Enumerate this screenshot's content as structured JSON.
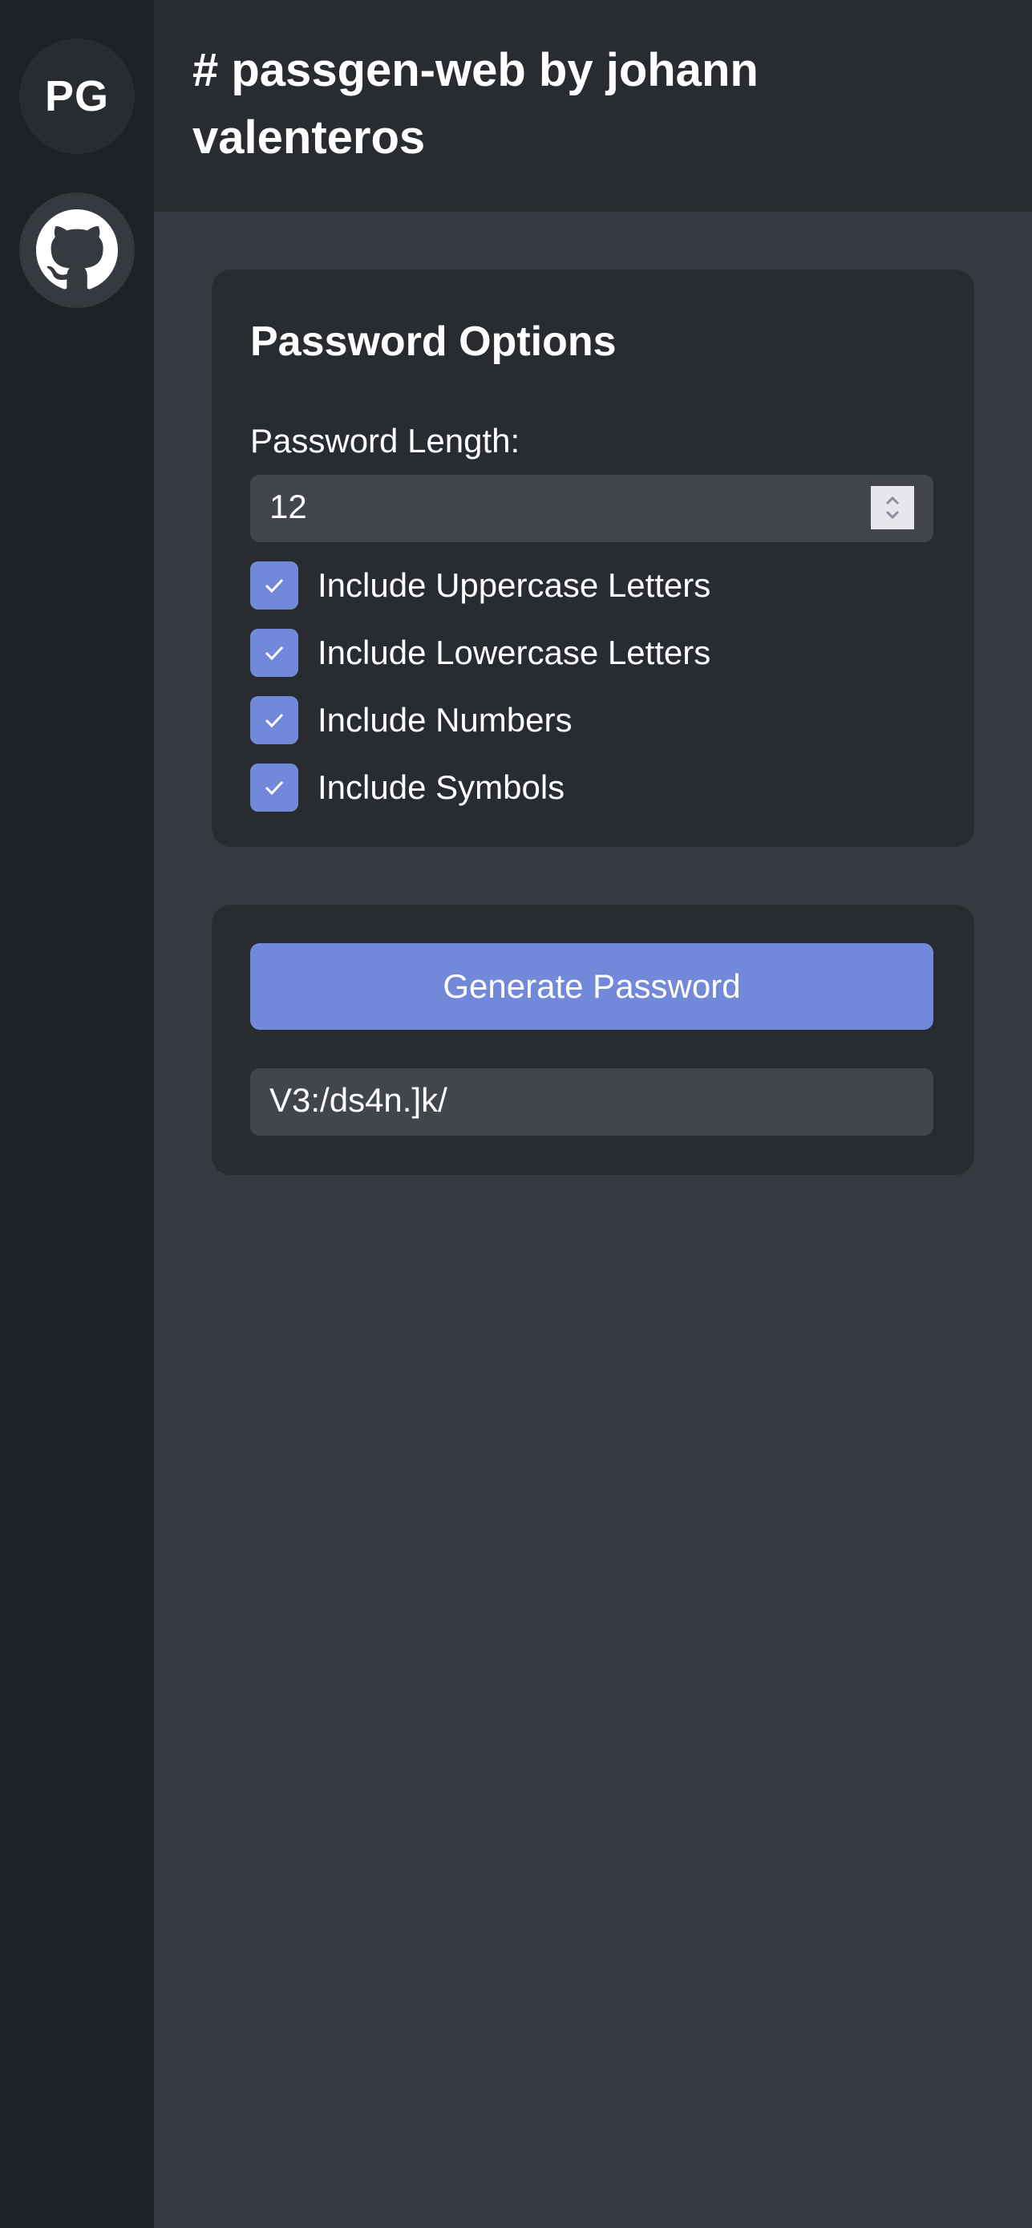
{
  "sidebar": {
    "logo_text": "PG",
    "github_icon": "github-icon"
  },
  "header": {
    "title": "# passgen-web by johann valenteros"
  },
  "options_card": {
    "title": "Password Options",
    "length_label": "Password Length:",
    "length_value": "12",
    "checkboxes": [
      {
        "label": "Include Uppercase Letters",
        "checked": true
      },
      {
        "label": "Include Lowercase Letters",
        "checked": true
      },
      {
        "label": "Include Numbers",
        "checked": true
      },
      {
        "label": "Include Symbols",
        "checked": true
      }
    ]
  },
  "generate_card": {
    "button_label": "Generate Password",
    "generated_password": "V3:/ds4n.]k/"
  },
  "colors": {
    "accent": "#7289da",
    "sidebar_bg": "#1e2124",
    "header_bg": "#282b30",
    "main_bg": "#36393f",
    "card_bg": "#282b30",
    "input_bg": "#424549"
  }
}
